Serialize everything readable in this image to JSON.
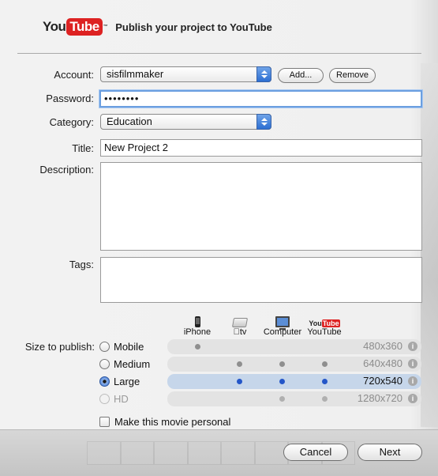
{
  "header": {
    "logo_you": "You",
    "logo_tube": "Tube",
    "logo_tm": "™",
    "title": "Publish your project to YouTube"
  },
  "form": {
    "account_label": "Account:",
    "account_value": "sisfilmmaker",
    "add_label": "Add...",
    "remove_label": "Remove",
    "password_label": "Password:",
    "password_value": "••••••••",
    "category_label": "Category:",
    "category_value": "Education",
    "title_label": "Title:",
    "title_value": "New Project 2",
    "description_label": "Description:",
    "description_value": "",
    "tags_label": "Tags:",
    "tags_value": ""
  },
  "publish": {
    "size_label": "Size to publish:",
    "devices": [
      {
        "name": "iPhone",
        "icon": "iphone-icon"
      },
      {
        "name": "tv",
        "icon": "apple-tv-icon"
      },
      {
        "name": "Computer",
        "icon": "computer-icon"
      },
      {
        "name": "YouTube",
        "icon": "youtube-icon"
      }
    ],
    "sizes": [
      {
        "label": "Mobile",
        "resolution": "480x360",
        "selected": false,
        "enabled": true
      },
      {
        "label": "Medium",
        "resolution": "640x480",
        "selected": false,
        "enabled": true
      },
      {
        "label": "Large",
        "resolution": "720x540",
        "selected": true,
        "enabled": true
      },
      {
        "label": "HD",
        "resolution": "1280x720",
        "selected": false,
        "enabled": false
      }
    ],
    "info_glyph": "i"
  },
  "personal": {
    "label": "Make this movie personal",
    "checked": false
  },
  "footer": {
    "cancel_label": "Cancel",
    "next_label": "Next"
  },
  "colors": {
    "youtube_red": "#dd2222",
    "accent_blue": "#2456c8"
  }
}
